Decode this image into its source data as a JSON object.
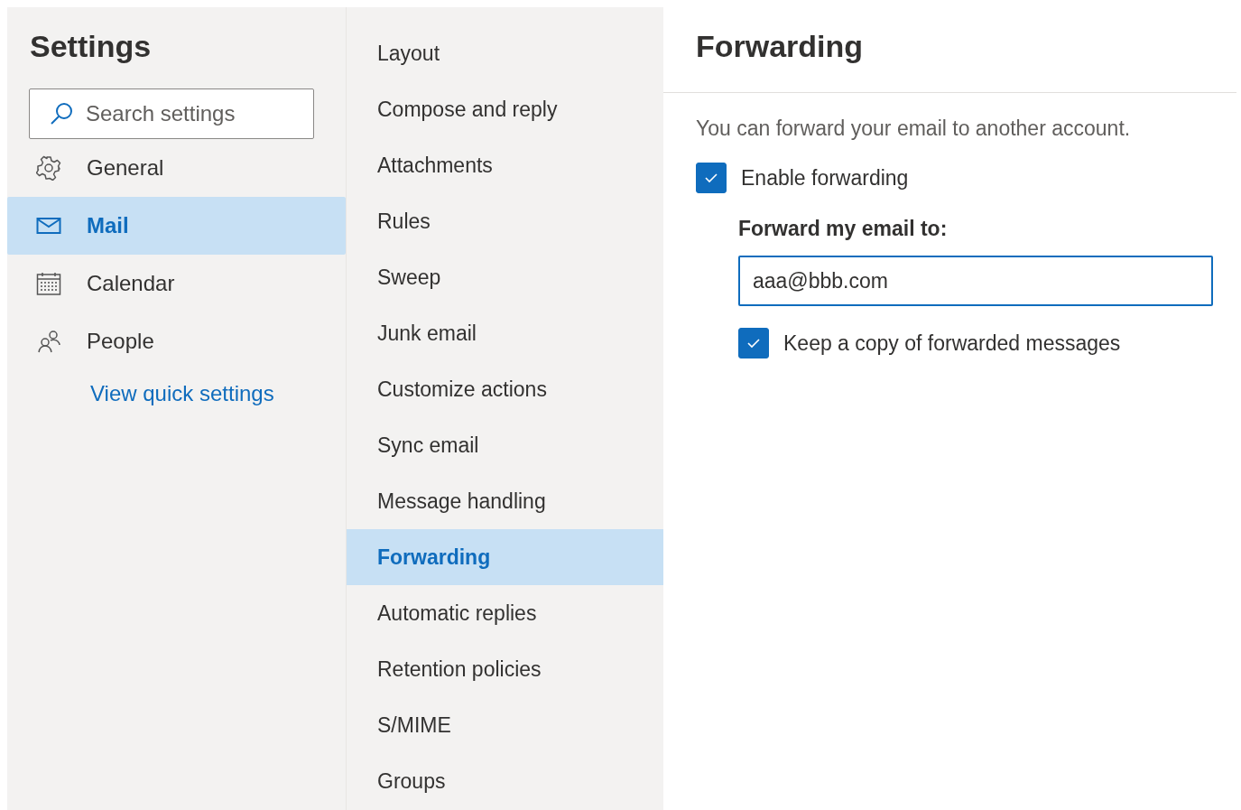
{
  "sidebar": {
    "title": "Settings",
    "search": {
      "placeholder": "Search settings"
    },
    "items": [
      {
        "label": "General",
        "selected": false
      },
      {
        "label": "Mail",
        "selected": true
      },
      {
        "label": "Calendar",
        "selected": false
      },
      {
        "label": "People",
        "selected": false
      }
    ],
    "link": "View quick settings"
  },
  "submenu": {
    "items": [
      {
        "label": "Layout",
        "selected": false
      },
      {
        "label": "Compose and reply",
        "selected": false
      },
      {
        "label": "Attachments",
        "selected": false
      },
      {
        "label": "Rules",
        "selected": false
      },
      {
        "label": "Sweep",
        "selected": false
      },
      {
        "label": "Junk email",
        "selected": false
      },
      {
        "label": "Customize actions",
        "selected": false
      },
      {
        "label": "Sync email",
        "selected": false
      },
      {
        "label": "Message handling",
        "selected": false
      },
      {
        "label": "Forwarding",
        "selected": true
      },
      {
        "label": "Automatic replies",
        "selected": false
      },
      {
        "label": "Retention policies",
        "selected": false
      },
      {
        "label": "S/MIME",
        "selected": false
      },
      {
        "label": "Groups",
        "selected": false
      }
    ]
  },
  "panel": {
    "title": "Forwarding",
    "description": "You can forward your email to another account.",
    "enable": {
      "label": "Enable forwarding",
      "checked": true
    },
    "field_label": "Forward my email to:",
    "field_value": "aaa@bbb.com",
    "keep_copy": {
      "label": "Keep a copy of forwarded messages",
      "checked": true
    }
  }
}
